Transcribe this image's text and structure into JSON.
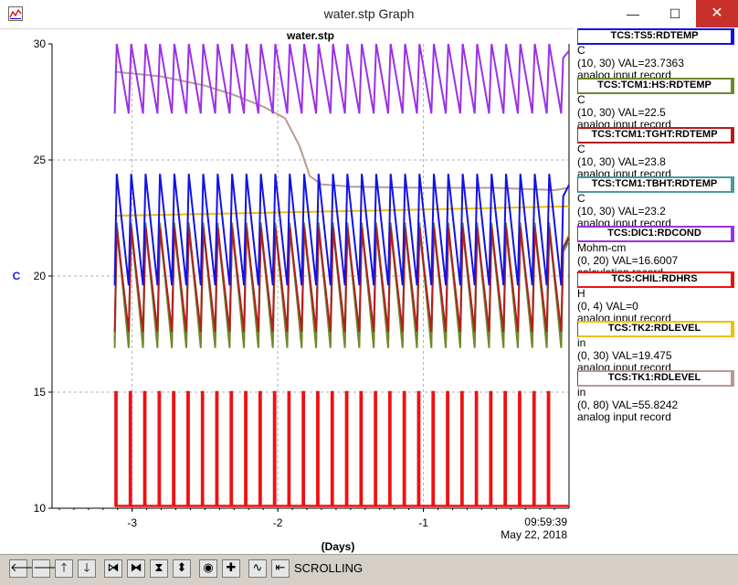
{
  "window": {
    "title": "water.stp Graph",
    "minimize": "—",
    "maximize": "☐",
    "close": "✕"
  },
  "colors": {
    "ts5": "#1212e6",
    "hs": "#6d8a2a",
    "tght": "#b21f1f",
    "tbht": "#4a9a9a",
    "dic1": "#9b30e8",
    "chil": "#ee1111",
    "tk2": "#f0c000",
    "tk1": "#b89a94"
  },
  "chart_data": {
    "type": "line",
    "title": "water.stp",
    "xlabel": "(Days)",
    "ylabel": "C",
    "xlim": [
      -3.55,
      0
    ],
    "ylim": [
      10,
      30
    ],
    "x_ticks": [
      "-3",
      "-2",
      "-1"
    ],
    "y_ticks": [
      "10",
      "15",
      "20",
      "25",
      "30"
    ],
    "time_label": "09:59:39",
    "date_label": "May 22, 2018",
    "grid": true,
    "cycle_period_days": 0.099,
    "data_start_x": -3.12,
    "series": [
      {
        "name": "TCS:TS5:RDTEMP",
        "color": "#1212e6",
        "pattern": "sawtooth",
        "low": 19.6,
        "high": 24.4
      },
      {
        "name": "TCS:TCM1:HS:RDTEMP",
        "color": "#6d8a2a",
        "pattern": "sawtooth",
        "low": 16.9,
        "high": 22.3
      },
      {
        "name": "TCS:TCM1:TGHT:RDTEMP",
        "color": "#b21f1f",
        "pattern": "sawtooth",
        "low": 17.6,
        "high": 22.1
      },
      {
        "name": "TCS:TCM1:TBHT:RDTEMP",
        "color": "#4a9a9a",
        "pattern": "sawtooth",
        "low": 17.2,
        "high": 22.0
      },
      {
        "name": "TCS:DIC1:RDCOND",
        "color": "#9b30e8",
        "pattern": "sawtooth",
        "low": 27.0,
        "high": 30.0
      },
      {
        "name": "TCS:CHIL:RDHRS",
        "color": "#ee1111",
        "pattern": "pulses",
        "low": 10.1,
        "high": 15.0
      },
      {
        "name": "TCS:TK2:RDLEVEL",
        "color": "#f0c000",
        "pattern": "ramp",
        "points": [
          [
            -3.12,
            22.6
          ],
          [
            -1.5,
            22.8
          ],
          [
            0,
            23.0
          ]
        ]
      },
      {
        "name": "TCS:TK1:RDLEVEL",
        "color": "#b89a94",
        "pattern": "curve",
        "points": [
          [
            -3.12,
            28.8
          ],
          [
            -2.8,
            28.6
          ],
          [
            -2.5,
            28.2
          ],
          [
            -2.3,
            27.8
          ],
          [
            -2.1,
            27.3
          ],
          [
            -1.95,
            26.8
          ],
          [
            -1.85,
            25.6
          ],
          [
            -1.78,
            24.3
          ],
          [
            -1.7,
            23.95
          ],
          [
            -1.5,
            23.85
          ],
          [
            -1.0,
            23.8
          ],
          [
            -0.5,
            23.8
          ],
          [
            -0.1,
            23.7
          ],
          [
            0,
            23.8
          ]
        ]
      }
    ]
  },
  "legend": [
    {
      "name": "TCS:TS5:RDTEMP",
      "unit": "C",
      "range": "(10, 30) VAL=23.7363",
      "record": "analog input record"
    },
    {
      "name": "TCS:TCM1:HS:RDTEMP",
      "unit": "C",
      "range": "(10, 30) VAL=22.5",
      "record": "analog input record"
    },
    {
      "name": "TCS:TCM1:TGHT:RDTEMP",
      "unit": "C",
      "range": "(10, 30) VAL=23.8",
      "record": "analog input record"
    },
    {
      "name": "TCS:TCM1:TBHT:RDTEMP",
      "unit": "C",
      "range": "(10, 30) VAL=23.2",
      "record": "analog input record"
    },
    {
      "name": "TCS:DIC1:RDCOND",
      "unit": "Mohm-cm",
      "range": "(0, 20) VAL=16.6007",
      "record": "calculation record"
    },
    {
      "name": "TCS:CHIL:RDHRS",
      "unit": "H",
      "range": "(0, 4) VAL=0",
      "record": "analog input record"
    },
    {
      "name": "TCS:TK2:RDLEVEL",
      "unit": "in",
      "range": "(0, 30) VAL=19.475",
      "record": "analog input record"
    },
    {
      "name": "TCS:TK1:RDLEVEL",
      "unit": "in",
      "range": "(0, 80) VAL=55.8242",
      "record": "analog input record"
    }
  ],
  "toolbar": {
    "buttons": [
      {
        "name": "scroll-left-button",
        "icon": "arrow-left-icon",
        "glyph": "🡐"
      },
      {
        "name": "scroll-right-button",
        "icon": "arrow-right-icon",
        "glyph": "🡒"
      },
      {
        "name": "scroll-up-button",
        "icon": "arrow-up-icon",
        "glyph": "🡑"
      },
      {
        "name": "scroll-down-button",
        "icon": "arrow-down-icon",
        "glyph": "🡓"
      },
      {
        "name": "compress-x-button",
        "icon": "compress-horizontal-icon",
        "glyph": "⧒"
      },
      {
        "name": "expand-x-button",
        "icon": "expand-horizontal-icon",
        "glyph": "⧓"
      },
      {
        "name": "compress-y-button",
        "icon": "compress-vertical-icon",
        "glyph": "⧗"
      },
      {
        "name": "expand-y-button",
        "icon": "expand-vertical-icon",
        "glyph": "⬍"
      },
      {
        "name": "record-button",
        "icon": "circle-icon",
        "glyph": "◉"
      },
      {
        "name": "add-button",
        "icon": "plus-icon",
        "glyph": "✚"
      },
      {
        "name": "waveform-button",
        "icon": "waveform-icon",
        "glyph": "∿"
      },
      {
        "name": "jump-end-button",
        "icon": "jump-end-icon",
        "glyph": "⇤"
      }
    ],
    "status": "SCROLLING"
  }
}
